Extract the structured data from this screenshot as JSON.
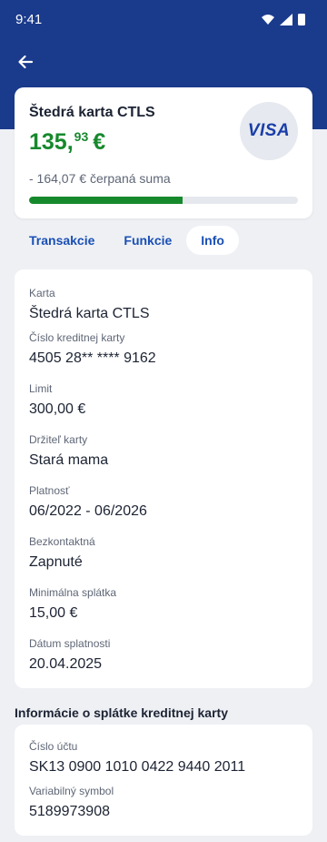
{
  "status_bar": {
    "time": "9:41"
  },
  "card": {
    "name": "Štedrá karta CTLS",
    "balance_int": "135,",
    "balance_dec": "93",
    "currency": "€",
    "brand": "VISA",
    "spent_text": "- 164,07 € čerpaná suma",
    "progress_fraction": 0.57,
    "accent_color": "#16892c"
  },
  "tabs": [
    {
      "label": "Transakcie",
      "active": false
    },
    {
      "label": "Funkcie",
      "active": false
    },
    {
      "label": "Info",
      "active": true
    }
  ],
  "info": [
    {
      "label": "Karta",
      "value": "Štedrá karta CTLS"
    },
    {
      "label": "Číslo kreditnej karty",
      "value": "4505 28** **** 9162"
    },
    {
      "label": "Limit",
      "value": "300,00 €"
    },
    {
      "label": "Držiteľ karty",
      "value": "Stará mama"
    },
    {
      "label": "Platnosť",
      "value": "06/2022 - 06/2026"
    },
    {
      "label": "Bezkontaktná",
      "value": "Zapnuté"
    },
    {
      "label": "Minimálna splátka",
      "value": "15,00 €"
    },
    {
      "label": "Dátum splatnosti",
      "value": "20.04.2025"
    }
  ],
  "payment_section": {
    "title": "Informácie o splátke kreditnej karty",
    "fields": [
      {
        "label": "Číslo účtu",
        "value": "SK13 0900 1010 0422 9440 2011"
      },
      {
        "label": "Variabilný symbol",
        "value": "5189973908"
      }
    ]
  },
  "icons": {
    "back": "arrow-left-icon",
    "wifi": "wifi-icon",
    "signal": "signal-icon",
    "battery": "battery-icon"
  }
}
